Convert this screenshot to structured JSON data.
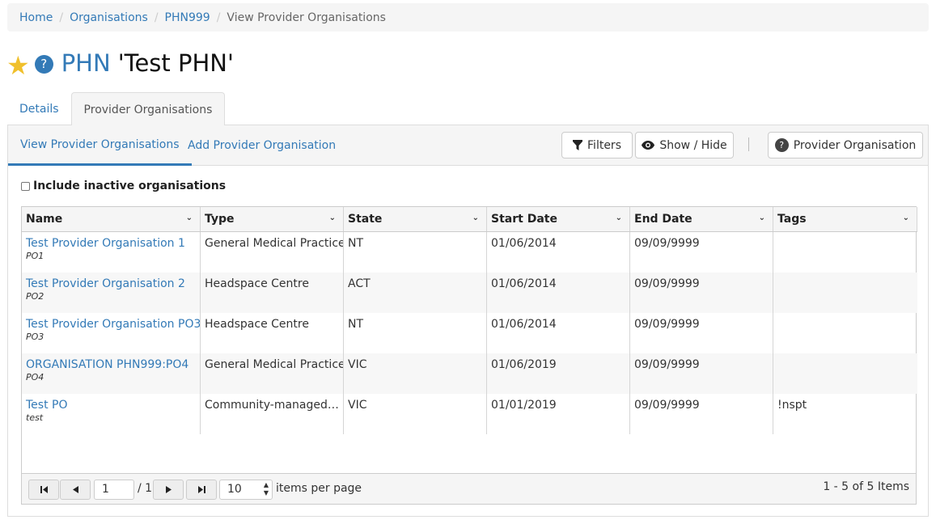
{
  "breadcrumb": {
    "items": [
      "Home",
      "Organisations",
      "PHN999"
    ],
    "current": "View Provider Organisations",
    "separator": "/"
  },
  "title": {
    "prefix": "PHN",
    "name": "'Test PHN'",
    "star_color": "#f0c02c"
  },
  "outer_tabs": [
    "Details",
    "Provider Organisations"
  ],
  "sub_tabs": [
    "View Provider Organisations",
    "Add Provider Organisation"
  ],
  "toolbar": {
    "filters": "Filters",
    "show_hide": "Show / Hide",
    "provider_org": "Provider Organisation"
  },
  "include_inactive": "Include inactive organisations",
  "grid": {
    "columns": [
      "Name",
      "Type",
      "State",
      "Start Date",
      "End Date",
      "Tags"
    ],
    "rows": [
      {
        "name": "Test Provider Organisation 1",
        "code": "PO1",
        "type": "General Medical Practice",
        "state": "NT",
        "start": "01/06/2014",
        "end": "09/09/9999",
        "tags": ""
      },
      {
        "name": "Test Provider Organisation 2",
        "code": "PO2",
        "type": "Headspace Centre",
        "state": "ACT",
        "start": "01/06/2014",
        "end": "09/09/9999",
        "tags": ""
      },
      {
        "name": "Test Provider Organisation PO3",
        "code": "PO3",
        "type": "Headspace Centre",
        "state": "NT",
        "start": "01/06/2014",
        "end": "09/09/9999",
        "tags": ""
      },
      {
        "name": "ORGANISATION PHN999:PO4",
        "code": "PO4",
        "type": "General Medical Practice",
        "state": "VIC",
        "start": "01/06/2019",
        "end": "09/09/9999",
        "tags": ""
      },
      {
        "name": "Test PO",
        "code": "test",
        "type": "Community-managed C...",
        "state": "VIC",
        "start": "01/01/2019",
        "end": "09/09/9999",
        "tags": "!nspt"
      }
    ]
  },
  "pager": {
    "page": "1",
    "of_pages": "/ 1",
    "page_size": "10",
    "per_page_label": "items per page",
    "summary": "1 - 5 of 5 Items"
  },
  "colors": {
    "link": "#337ab7",
    "header_bg": "#f5f5f5",
    "border": "#dddddd"
  }
}
